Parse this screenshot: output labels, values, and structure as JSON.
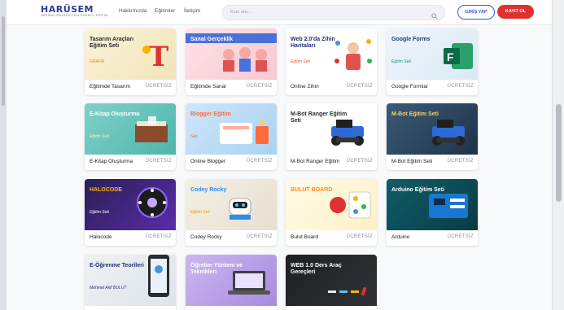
{
  "header": {
    "logo_name": "HARÜSEM",
    "logo_tagline": "HARRAN ÜNİVERSİTESİ SÜREKLİ EĞİTİM",
    "nav": [
      "Hakkımızda",
      "Eğitimler",
      "İletişim"
    ],
    "search_placeholder": "Kurs ara...",
    "login_label": "GİRİŞ YAP",
    "register_label": "KAYIT OL"
  },
  "colors": {
    "brand": "#2d3f8f",
    "accent": "#3b5bdb",
    "register": "#e03131"
  },
  "courses": [
    {
      "title": "Eğitimde Tasarım",
      "price": "ÜCRETSİZ",
      "thumb": "Tasarım Araçları Eğitim Seti",
      "thumb_extra": "GRAFİK",
      "icon": "pen-tool-icon"
    },
    {
      "title": "Eğitimde Sanal",
      "price": "ÜCRETSİZ",
      "thumb": "Sanal Gerçeklik",
      "thumb_extra": "",
      "icon": "vr-headset-icon"
    },
    {
      "title": "Online Zihin",
      "price": "ÜCRETSİZ",
      "thumb": "Web 2.0'da Zihin Haritaları",
      "thumb_extra": "Eğitim Seti",
      "icon": "mind-map-icon"
    },
    {
      "title": "Google Formlar",
      "price": "ÜCRETSİZ",
      "thumb": "Google Forms",
      "thumb_extra": "Eğitim Seti",
      "icon": "forms-logo-icon"
    },
    {
      "title": "E-Kitap Oluşturma",
      "price": "ÜCRETSİZ",
      "thumb": "E-Kitap Oluşturma",
      "thumb_extra": "Eğitim Seti",
      "icon": "book-icon"
    },
    {
      "title": "Online Blogger",
      "price": "ÜCRETSİZ",
      "thumb": "Blogger Eğitim",
      "thumb_extra": "Seti",
      "icon": "blog-icon"
    },
    {
      "title": "M-Bot Ranger Eğitim",
      "price": "ÜCRETSİZ",
      "thumb": "M-Bot Ranger Eğitim Seti",
      "thumb_extra": "",
      "icon": "robot-icon"
    },
    {
      "title": "M-Bot Eğitim Seti",
      "price": "ÜCRETSİZ",
      "thumb": "M-Bot Eğitim Seti",
      "thumb_extra": "",
      "icon": "robot-icon"
    },
    {
      "title": "Halocode",
      "price": "ÜCRETSİZ",
      "thumb": "HALOCODE",
      "thumb_extra": "Eğitim Seti",
      "icon": "circuit-icon"
    },
    {
      "title": "Codey Rocky",
      "price": "ÜCRETSİZ",
      "thumb": "Codey Rocky",
      "thumb_extra": "Eğitim Seti",
      "icon": "robot-icon"
    },
    {
      "title": "Bulut Board",
      "price": "ÜCRETSİZ",
      "thumb": "BULUT BOARD",
      "thumb_extra": "",
      "icon": "board-icon"
    },
    {
      "title": "Arduino",
      "price": "ÜCRETSİZ",
      "thumb": "Arduino Eğitim Seti",
      "thumb_extra": "",
      "icon": "circuit-icon"
    },
    {
      "title": "",
      "price": "",
      "thumb": "E-Öğrenme Teorileri",
      "thumb_extra": "Mehmet Akif BULUT",
      "icon": "phone-icon"
    },
    {
      "title": "",
      "price": "",
      "thumb": "Öğretim Yöntem ve Teknikleri",
      "thumb_extra": "",
      "icon": "laptop-icon"
    },
    {
      "title": "",
      "price": "",
      "thumb": "WEB 1.0 Ders Araç Gereçleri",
      "thumb_extra": "",
      "icon": "chalkboard-icon"
    }
  ]
}
